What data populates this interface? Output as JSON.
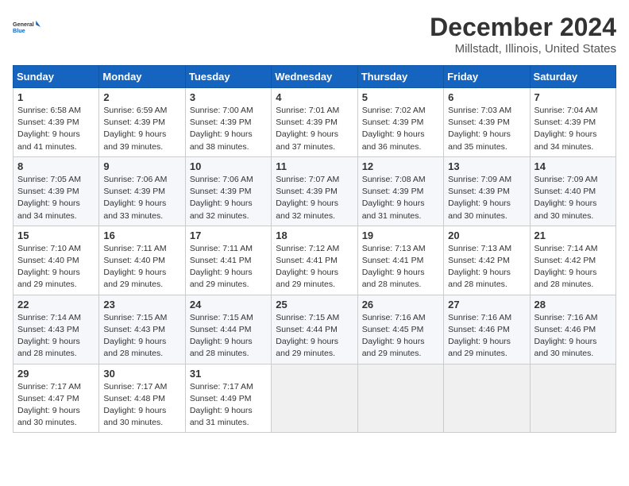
{
  "logo": {
    "line1": "General",
    "line2": "Blue"
  },
  "title": "December 2024",
  "subtitle": "Millstadt, Illinois, United States",
  "days_of_week": [
    "Sunday",
    "Monday",
    "Tuesday",
    "Wednesday",
    "Thursday",
    "Friday",
    "Saturday"
  ],
  "weeks": [
    [
      {
        "day": "1",
        "sunrise": "6:58 AM",
        "sunset": "4:39 PM",
        "daylight": "9 hours and 41 minutes."
      },
      {
        "day": "2",
        "sunrise": "6:59 AM",
        "sunset": "4:39 PM",
        "daylight": "9 hours and 39 minutes."
      },
      {
        "day": "3",
        "sunrise": "7:00 AM",
        "sunset": "4:39 PM",
        "daylight": "9 hours and 38 minutes."
      },
      {
        "day": "4",
        "sunrise": "7:01 AM",
        "sunset": "4:39 PM",
        "daylight": "9 hours and 37 minutes."
      },
      {
        "day": "5",
        "sunrise": "7:02 AM",
        "sunset": "4:39 PM",
        "daylight": "9 hours and 36 minutes."
      },
      {
        "day": "6",
        "sunrise": "7:03 AM",
        "sunset": "4:39 PM",
        "daylight": "9 hours and 35 minutes."
      },
      {
        "day": "7",
        "sunrise": "7:04 AM",
        "sunset": "4:39 PM",
        "daylight": "9 hours and 34 minutes."
      }
    ],
    [
      {
        "day": "8",
        "sunrise": "7:05 AM",
        "sunset": "4:39 PM",
        "daylight": "9 hours and 34 minutes."
      },
      {
        "day": "9",
        "sunrise": "7:06 AM",
        "sunset": "4:39 PM",
        "daylight": "9 hours and 33 minutes."
      },
      {
        "day": "10",
        "sunrise": "7:06 AM",
        "sunset": "4:39 PM",
        "daylight": "9 hours and 32 minutes."
      },
      {
        "day": "11",
        "sunrise": "7:07 AM",
        "sunset": "4:39 PM",
        "daylight": "9 hours and 32 minutes."
      },
      {
        "day": "12",
        "sunrise": "7:08 AM",
        "sunset": "4:39 PM",
        "daylight": "9 hours and 31 minutes."
      },
      {
        "day": "13",
        "sunrise": "7:09 AM",
        "sunset": "4:39 PM",
        "daylight": "9 hours and 30 minutes."
      },
      {
        "day": "14",
        "sunrise": "7:09 AM",
        "sunset": "4:40 PM",
        "daylight": "9 hours and 30 minutes."
      }
    ],
    [
      {
        "day": "15",
        "sunrise": "7:10 AM",
        "sunset": "4:40 PM",
        "daylight": "9 hours and 29 minutes."
      },
      {
        "day": "16",
        "sunrise": "7:11 AM",
        "sunset": "4:40 PM",
        "daylight": "9 hours and 29 minutes."
      },
      {
        "day": "17",
        "sunrise": "7:11 AM",
        "sunset": "4:41 PM",
        "daylight": "9 hours and 29 minutes."
      },
      {
        "day": "18",
        "sunrise": "7:12 AM",
        "sunset": "4:41 PM",
        "daylight": "9 hours and 29 minutes."
      },
      {
        "day": "19",
        "sunrise": "7:13 AM",
        "sunset": "4:41 PM",
        "daylight": "9 hours and 28 minutes."
      },
      {
        "day": "20",
        "sunrise": "7:13 AM",
        "sunset": "4:42 PM",
        "daylight": "9 hours and 28 minutes."
      },
      {
        "day": "21",
        "sunrise": "7:14 AM",
        "sunset": "4:42 PM",
        "daylight": "9 hours and 28 minutes."
      }
    ],
    [
      {
        "day": "22",
        "sunrise": "7:14 AM",
        "sunset": "4:43 PM",
        "daylight": "9 hours and 28 minutes."
      },
      {
        "day": "23",
        "sunrise": "7:15 AM",
        "sunset": "4:43 PM",
        "daylight": "9 hours and 28 minutes."
      },
      {
        "day": "24",
        "sunrise": "7:15 AM",
        "sunset": "4:44 PM",
        "daylight": "9 hours and 28 minutes."
      },
      {
        "day": "25",
        "sunrise": "7:15 AM",
        "sunset": "4:44 PM",
        "daylight": "9 hours and 29 minutes."
      },
      {
        "day": "26",
        "sunrise": "7:16 AM",
        "sunset": "4:45 PM",
        "daylight": "9 hours and 29 minutes."
      },
      {
        "day": "27",
        "sunrise": "7:16 AM",
        "sunset": "4:46 PM",
        "daylight": "9 hours and 29 minutes."
      },
      {
        "day": "28",
        "sunrise": "7:16 AM",
        "sunset": "4:46 PM",
        "daylight": "9 hours and 30 minutes."
      }
    ],
    [
      {
        "day": "29",
        "sunrise": "7:17 AM",
        "sunset": "4:47 PM",
        "daylight": "9 hours and 30 minutes."
      },
      {
        "day": "30",
        "sunrise": "7:17 AM",
        "sunset": "4:48 PM",
        "daylight": "9 hours and 30 minutes."
      },
      {
        "day": "31",
        "sunrise": "7:17 AM",
        "sunset": "4:49 PM",
        "daylight": "9 hours and 31 minutes."
      },
      null,
      null,
      null,
      null
    ]
  ]
}
